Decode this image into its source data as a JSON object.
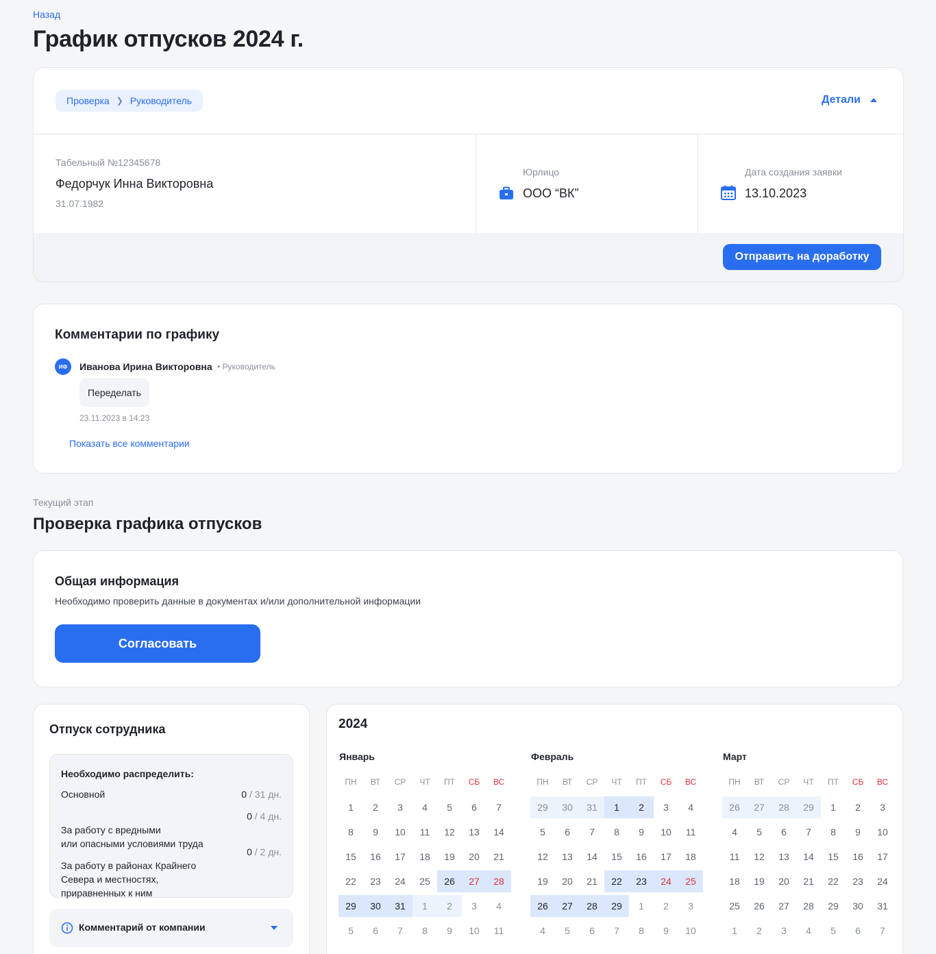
{
  "back_label": "Назад",
  "page_title": "График отпусков 2024 г.",
  "header_card": {
    "breadcrumb": [
      "Проверка",
      "Руководитель"
    ],
    "details_label": "Детали",
    "employee": {
      "tab_number": "Табельный №12345678",
      "name": "Федорчук Инна Викторовна",
      "birth_date": "31.07.1982"
    },
    "entity": {
      "label": "Юрлицо",
      "value": "ООО “ВК”",
      "icon": "briefcase-icon"
    },
    "created": {
      "label": "Дата создания заявки",
      "value": "13.10.2023",
      "icon": "calendar-icon"
    },
    "rework_button": "Отправить на доработку"
  },
  "comments": {
    "title": "Комментарии по графику",
    "items": [
      {
        "avatar_initials": "ИФ",
        "author": "Иванова Ирина Викторовна",
        "role": "• Руководитель",
        "text": "Переделать",
        "timestamp": "23.11.2023 в 14:23"
      }
    ],
    "show_all": "Показать все комментарии"
  },
  "stage": {
    "label": "Текущий этап",
    "title": "Проверка графика отпусков"
  },
  "general_info": {
    "title": "Общая информация",
    "description": "Необходимо проверить данные в документах и/или дополнительной информации",
    "approve_button": "Согласовать"
  },
  "employee_vacation": {
    "title": "Отпуск сотрудника",
    "distribute_title": "Необходимо распределить:",
    "rows": [
      {
        "label": "Основной",
        "value": "0",
        "unit": " / 31 дн."
      },
      {
        "label": "За работу с вредными\nили опасными условиями труда",
        "value": "0",
        "unit": " / 4 дн."
      },
      {
        "label": "За работу в районах Крайнего\nСевера и местностях,\nприравненных к ним",
        "value": "0",
        "unit": " / 2 дн."
      }
    ],
    "company_comment": "Комментарий от компании"
  },
  "calendar": {
    "year": "2024",
    "weekdays": [
      "ПН",
      "ВТ",
      "СР",
      "ЧТ",
      "ПТ",
      "СБ",
      "ВС"
    ],
    "accent_weekend": "#e0323c",
    "months": [
      {
        "name": "Январь",
        "weeks": [
          [
            "1",
            "2",
            "3",
            "4",
            "5",
            "6",
            "7"
          ],
          [
            "8",
            "9",
            "10",
            "11",
            "12",
            "13",
            "14"
          ],
          [
            "15",
            "16",
            "17",
            "18",
            "19",
            "20",
            "21"
          ],
          [
            "22",
            "23",
            "24",
            "25",
            "26",
            "27",
            "28"
          ],
          [
            "29",
            "30",
            "31",
            "1",
            "2",
            "3",
            "4"
          ],
          [
            "5",
            "6",
            "7",
            "8",
            "9",
            "10",
            "11"
          ]
        ],
        "highlight": [
          [
            3,
            4
          ],
          [
            3,
            5
          ],
          [
            3,
            6
          ],
          [
            4,
            0
          ],
          [
            4,
            1
          ],
          [
            4,
            2
          ]
        ],
        "highlight_light": [
          [
            4,
            3
          ],
          [
            4,
            4
          ]
        ],
        "current": [
          [
            0,
            0
          ],
          [
            4,
            2
          ]
        ]
      },
      {
        "name": "Февраль",
        "weeks": [
          [
            "29",
            "30",
            "31",
            "1",
            "2",
            "3",
            "4"
          ],
          [
            "5",
            "6",
            "7",
            "8",
            "9",
            "10",
            "11"
          ],
          [
            "12",
            "13",
            "14",
            "15",
            "16",
            "17",
            "18"
          ],
          [
            "19",
            "20",
            "21",
            "22",
            "23",
            "24",
            "25"
          ],
          [
            "26",
            "27",
            "28",
            "29",
            "1",
            "2",
            "3"
          ],
          [
            "4",
            "5",
            "6",
            "7",
            "8",
            "9",
            "10"
          ]
        ],
        "highlight": [
          [
            0,
            3
          ],
          [
            0,
            4
          ],
          [
            3,
            3
          ],
          [
            3,
            4
          ],
          [
            3,
            5
          ],
          [
            3,
            6
          ],
          [
            4,
            0
          ],
          [
            4,
            1
          ],
          [
            4,
            2
          ],
          [
            4,
            3
          ]
        ],
        "highlight_light": [
          [
            0,
            0
          ],
          [
            0,
            1
          ],
          [
            0,
            2
          ]
        ],
        "current": [
          [
            0,
            3
          ],
          [
            4,
            3
          ]
        ]
      },
      {
        "name": "Март",
        "weeks": [
          [
            "26",
            "27",
            "28",
            "29",
            "1",
            "2",
            "3"
          ],
          [
            "4",
            "5",
            "6",
            "7",
            "8",
            "9",
            "10"
          ],
          [
            "11",
            "12",
            "13",
            "14",
            "15",
            "16",
            "17"
          ],
          [
            "18",
            "19",
            "20",
            "21",
            "22",
            "23",
            "24"
          ],
          [
            "25",
            "26",
            "27",
            "28",
            "29",
            "30",
            "31"
          ],
          [
            "1",
            "2",
            "3",
            "4",
            "5",
            "6",
            "7"
          ]
        ],
        "highlight": [],
        "highlight_light": [
          [
            0,
            0
          ],
          [
            0,
            1
          ],
          [
            0,
            2
          ],
          [
            0,
            3
          ]
        ],
        "current": [
          [
            0,
            4
          ],
          [
            4,
            6
          ]
        ]
      }
    ]
  }
}
